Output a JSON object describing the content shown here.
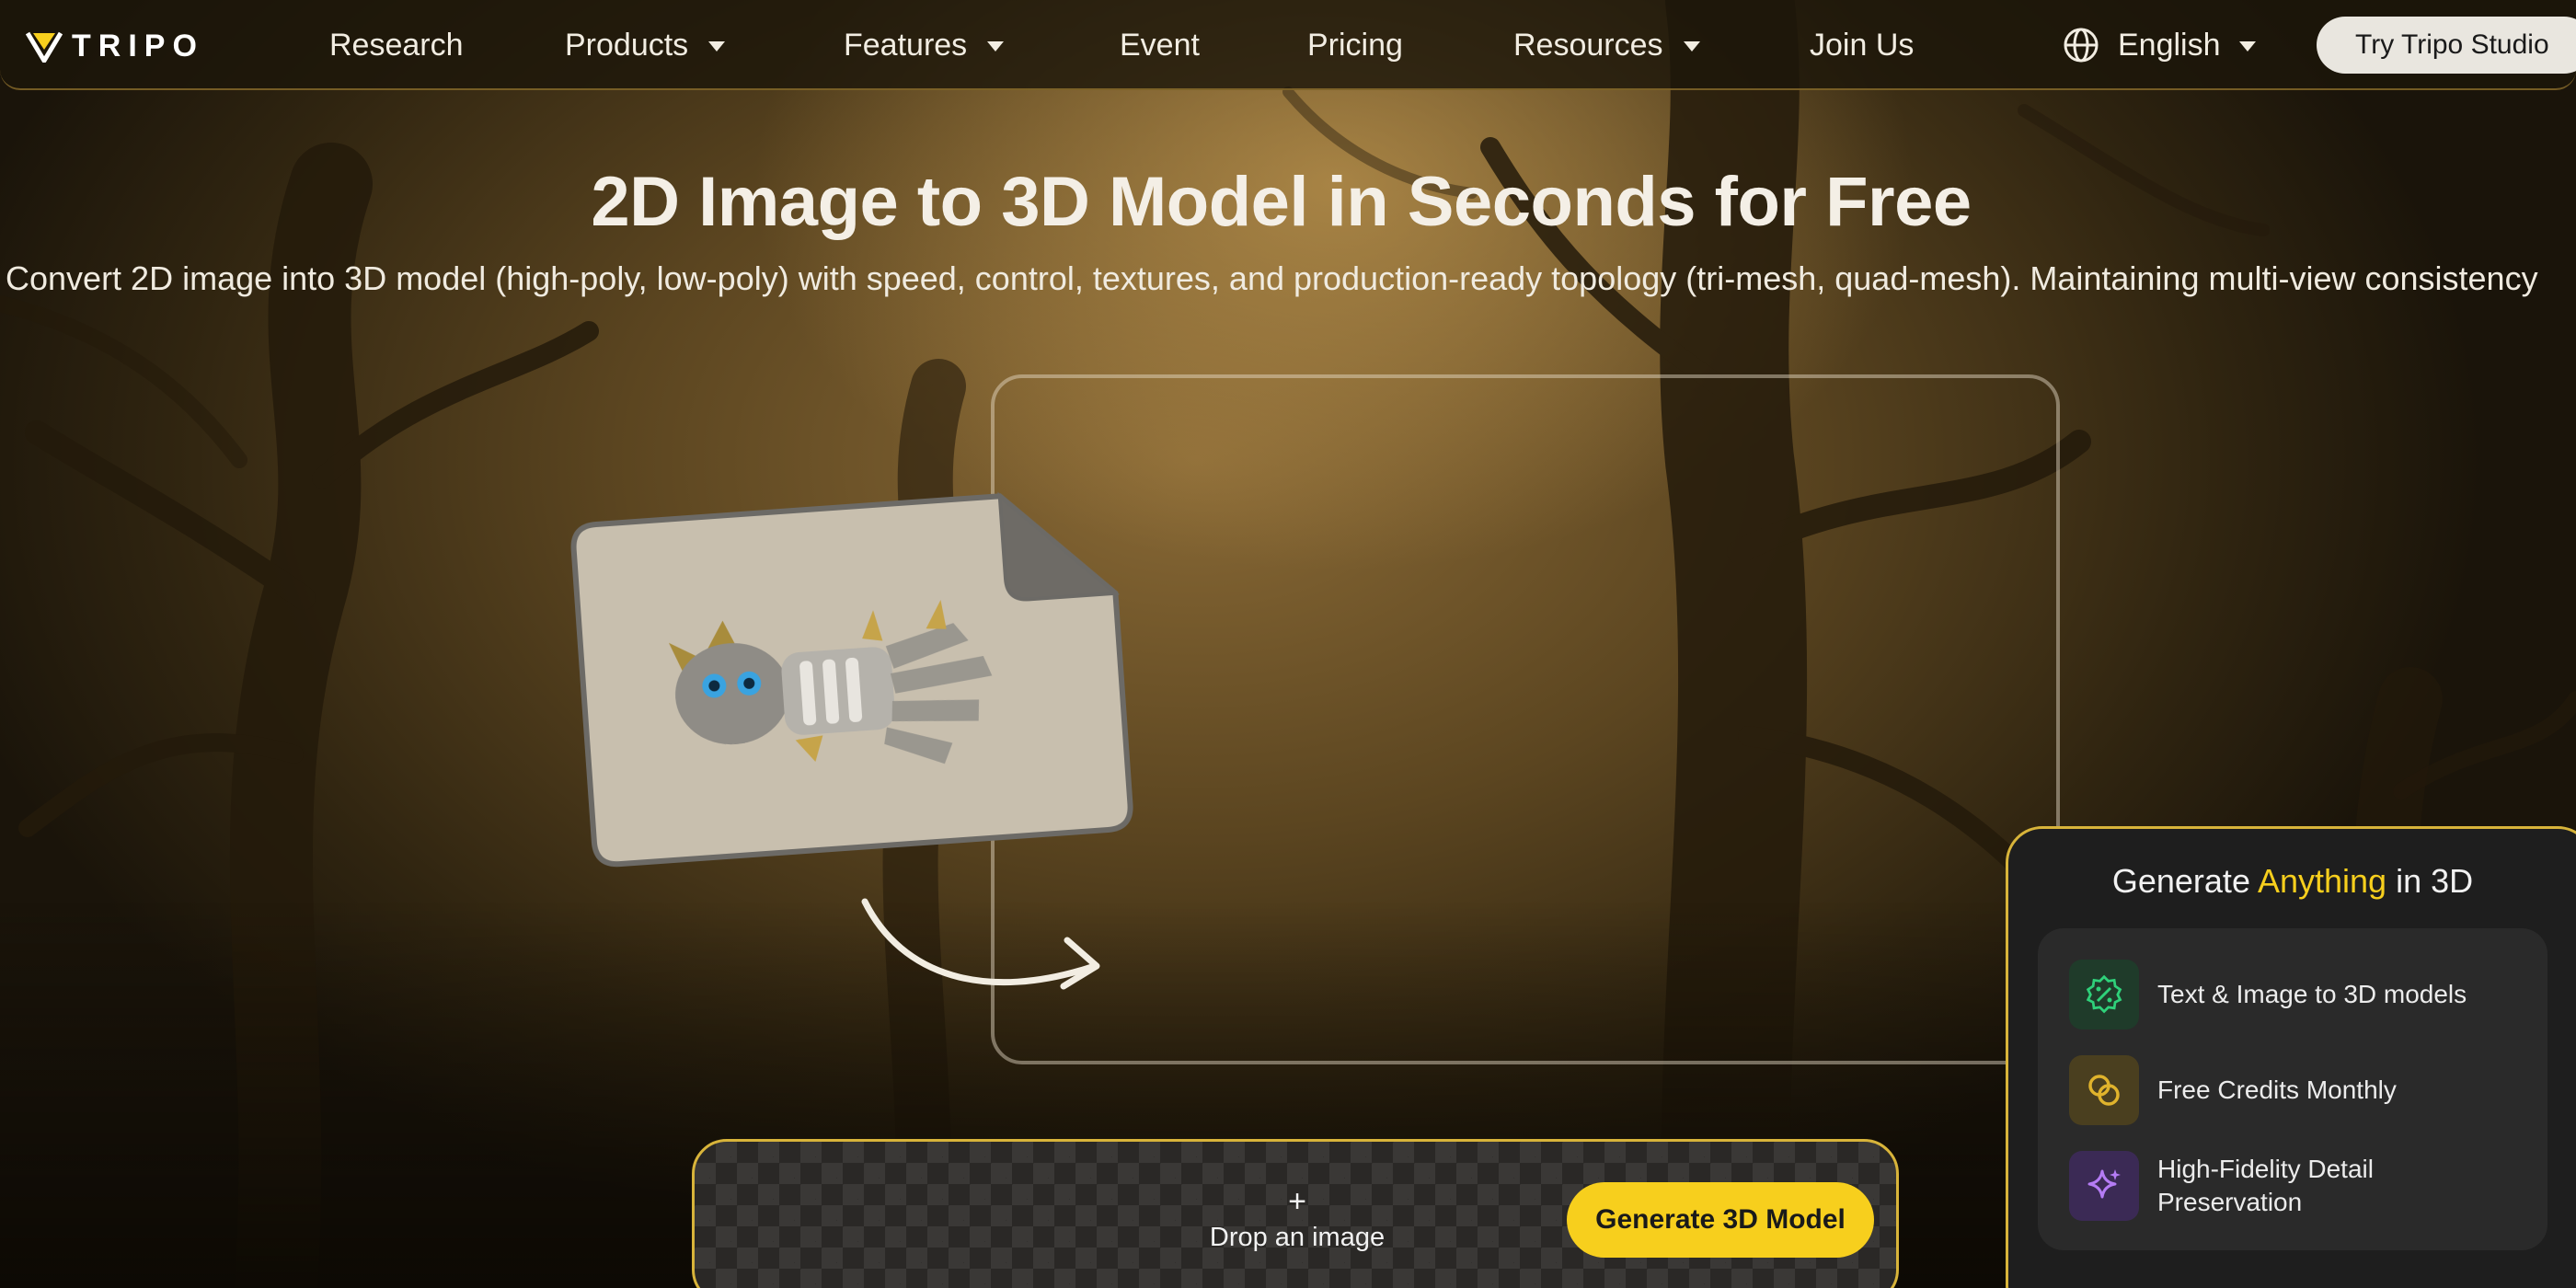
{
  "nav": {
    "logo": "TRIPO",
    "items": [
      {
        "label": "Research",
        "dropdown": false
      },
      {
        "label": "Products",
        "dropdown": true
      },
      {
        "label": "Features",
        "dropdown": true
      },
      {
        "label": "Event",
        "dropdown": false
      },
      {
        "label": "Pricing",
        "dropdown": false
      },
      {
        "label": "Resources",
        "dropdown": true
      },
      {
        "label": "Join Us",
        "dropdown": false
      }
    ],
    "language": "English",
    "cta": "Try Tripo Studio"
  },
  "hero": {
    "title": "2D Image to 3D Model in Seconds for Free",
    "subtitle": "Convert 2D image into 3D model (high-poly, low-poly) with speed, control, textures, and production-ready topology (tri-mesh, quad-mesh). Maintaining multi-view consistency"
  },
  "uploader": {
    "plus": "+",
    "drop_label": "Drop an image",
    "generate_label": "Generate 3D Model"
  },
  "promo": {
    "title_before": "Generate ",
    "title_accent": "Anything",
    "title_after": " in 3D",
    "features": [
      {
        "label": "Text & Image to 3D models",
        "icon": "badge-percent-icon",
        "color": "#2fd17a"
      },
      {
        "label": "Free Credits Monthly",
        "icon": "coins-icon",
        "color": "#e0b32c"
      },
      {
        "label": "High-Fidelity Detail Preservation",
        "icon": "sparkles-icon",
        "color": "#b57cf5"
      }
    ]
  },
  "colors": {
    "accent": "#f7cf1d",
    "border_gold": "#d8b43a"
  }
}
